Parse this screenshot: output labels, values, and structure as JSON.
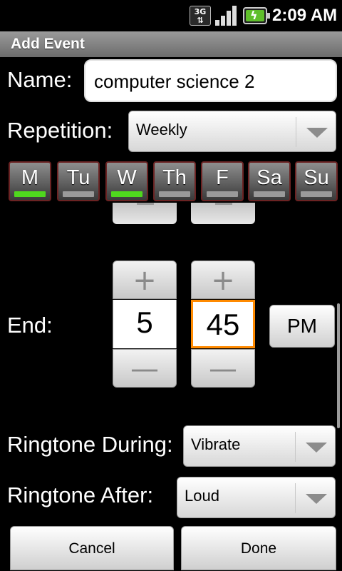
{
  "status_bar": {
    "network": "3G",
    "signal_icon": "signal-bars-icon",
    "battery_icon": "battery-charging-icon",
    "time": "2:09 AM"
  },
  "title_bar": {
    "title": "Add Event"
  },
  "form": {
    "name_label": "Name:",
    "name_value": "computer science 2",
    "repetition_label": "Repetition:",
    "repetition_value": "Weekly",
    "days": [
      {
        "label": "M",
        "selected": true
      },
      {
        "label": "Tu",
        "selected": false
      },
      {
        "label": "W",
        "selected": true
      },
      {
        "label": "Th",
        "selected": false
      },
      {
        "label": "F",
        "selected": false
      },
      {
        "label": "Sa",
        "selected": false
      },
      {
        "label": "Su",
        "selected": false
      }
    ],
    "end_label": "End:",
    "end_time": {
      "hour": "5",
      "minute": "45",
      "ampm": "PM",
      "plus_glyph": "+",
      "minus_glyph": "—"
    },
    "ringtone_during_label": "Ringtone During:",
    "ringtone_during_value": "Vibrate",
    "ringtone_after_label": "Ringtone After:",
    "ringtone_after_value": "Loud"
  },
  "buttons": {
    "cancel": "Cancel",
    "done": "Done"
  },
  "colors": {
    "day_selected_indicator": "#4fd81e",
    "focused_border": "#ff8a00",
    "day_border": "#6b2323"
  }
}
